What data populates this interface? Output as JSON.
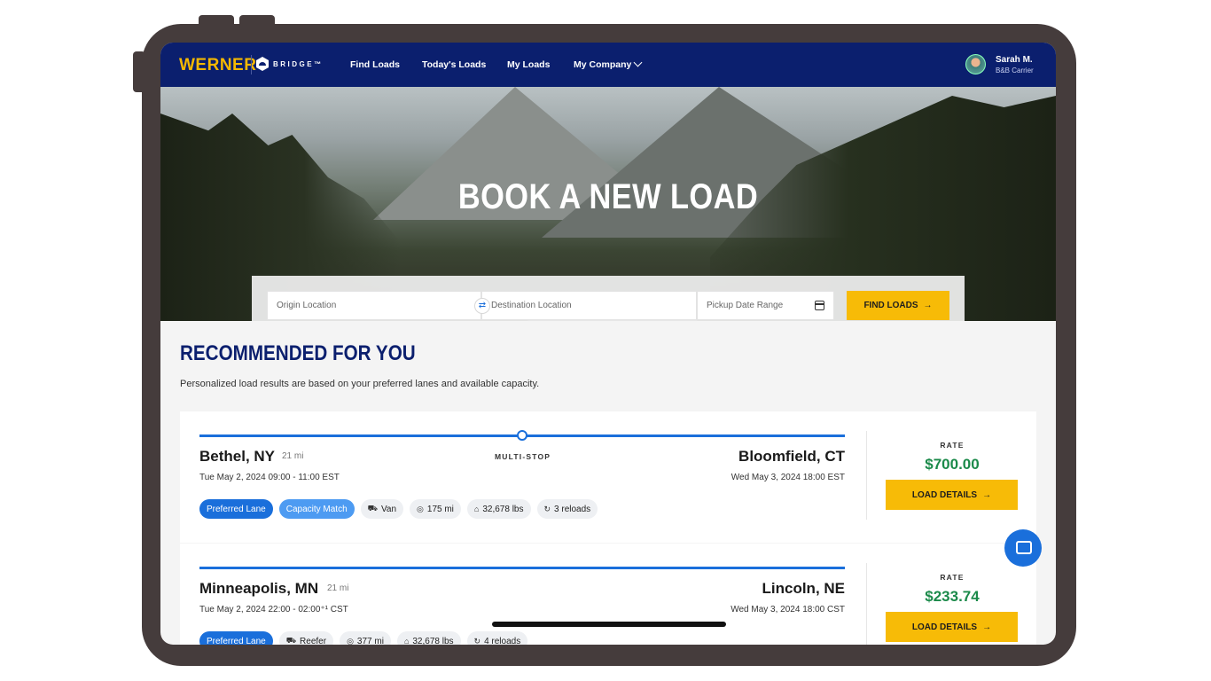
{
  "nav": {
    "brand": "WERNER",
    "bridge": "BRIDGE™",
    "links": [
      "Find Loads",
      "Today's Loads",
      "My Loads",
      "My Company"
    ],
    "user_name": "Sarah M.",
    "user_company": "B&B Carrier"
  },
  "hero": {
    "title": "BOOK A NEW LOAD",
    "origin_placeholder": "Origin Location",
    "destination_placeholder": "Destination Location",
    "pickup_placeholder": "Pickup Date Range",
    "find_button": "FIND LOADS"
  },
  "recommended": {
    "title": "RECOMMENDED FOR YOU",
    "subtitle": "Personalized load results are based on your preferred lanes and available capacity."
  },
  "loads": [
    {
      "origin": "Bethel, NY",
      "origin_miles": "21 mi",
      "stop_type": "MULTI-STOP",
      "destination": "Bloomfield, CT",
      "pickup": "Tue May 2, 2024    09:00 - 11:00 EST",
      "dropoff": "Wed May 3, 2024    18:00 EST",
      "rate_label": "RATE",
      "rate": "$700.00",
      "details_button": "LOAD DETAILS",
      "tags": [
        "Preferred Lane",
        "Capacity Match"
      ],
      "equipment": "Van",
      "distance": "175 mi",
      "weight": "32,678 lbs",
      "reloads": "3 reloads"
    },
    {
      "origin": "Minneapolis, MN",
      "origin_miles": "21 mi",
      "destination": "Lincoln, NE",
      "pickup": "Tue May 2, 2024    22:00 - 02:00⁺¹ CST",
      "dropoff": "Wed May 3, 2024    18:00 CST",
      "rate_label": "RATE",
      "rate": "$233.74",
      "details_button": "LOAD DETAILS",
      "tags": [
        "Preferred Lane"
      ],
      "equipment": "Reefer",
      "distance": "377 mi",
      "weight": "32,678 lbs",
      "reloads": "4 reloads"
    }
  ],
  "colors": {
    "nav_bg": "#0b1f6e",
    "brand_yellow": "#f5b800",
    "button_yellow": "#f7bb07",
    "accent_blue": "#1a6fdb",
    "rate_green": "#1b8a4a"
  }
}
